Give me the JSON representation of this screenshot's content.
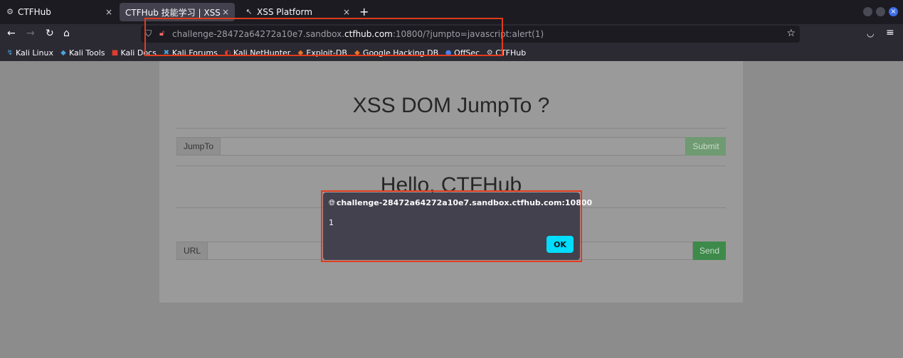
{
  "tabs": [
    {
      "title": "CTFHub",
      "icon": "ctfhub-icon",
      "close": "×"
    },
    {
      "title": "CTFHub 技能学习 | XSS DOM",
      "icon": "",
      "close": "×"
    },
    {
      "title": "XSS Platform",
      "icon": "xss-platform-icon",
      "close": "×"
    }
  ],
  "new_tab": "+",
  "nav": {
    "back": "←",
    "forward": "→",
    "reload": "↻",
    "home": "⌂",
    "url_prefix": "challenge-28472a64272a10e7.sandbox.",
    "url_domain": "ctfhub.com",
    "url_suffix": ":10800/?jumpto=javascript:alert(1)",
    "star": "☆",
    "pocket": "◡",
    "menu": "≡"
  },
  "bookmarks": [
    {
      "label": "Kali Linux",
      "icon": "kali-icon",
      "color": "#4aa3df"
    },
    {
      "label": "Kali Tools",
      "icon": "kali-tools-icon",
      "color": "#4aa3df"
    },
    {
      "label": "Kali Docs",
      "icon": "kali-docs-icon",
      "color": "#e03c31"
    },
    {
      "label": "Kali Forums",
      "icon": "kali-forums-icon",
      "color": "#4aa3df"
    },
    {
      "label": "Kali NetHunter",
      "icon": "nethunter-icon",
      "color": "#e03c31"
    },
    {
      "label": "Exploit-DB",
      "icon": "exploit-db-icon",
      "color": "#e8742a"
    },
    {
      "label": "Google Hacking DB",
      "icon": "ghdb-icon",
      "color": "#e8742a"
    },
    {
      "label": "OffSec",
      "icon": "offsec-icon",
      "color": "#4a7fe8"
    },
    {
      "label": "CTFHub",
      "icon": "ctfhub-icon",
      "color": "#cfcfd8"
    }
  ],
  "page": {
    "title": "XSS DOM JumpTo ?",
    "jumpto_label": "JumpTo",
    "submit_label": "Submit",
    "hello": "Hello, CTFHub",
    "url_label": "URL",
    "send_label": "Send"
  },
  "alert": {
    "origin": "challenge-28472a64272a10e7.sandbox.ctfhub.com:10800",
    "message": "1",
    "ok_label": "OK"
  },
  "colors": {
    "highlight": "#e23b1c",
    "ok_button": "#00ddff",
    "submit": "#6f9a72",
    "send": "#3d8a4a"
  }
}
